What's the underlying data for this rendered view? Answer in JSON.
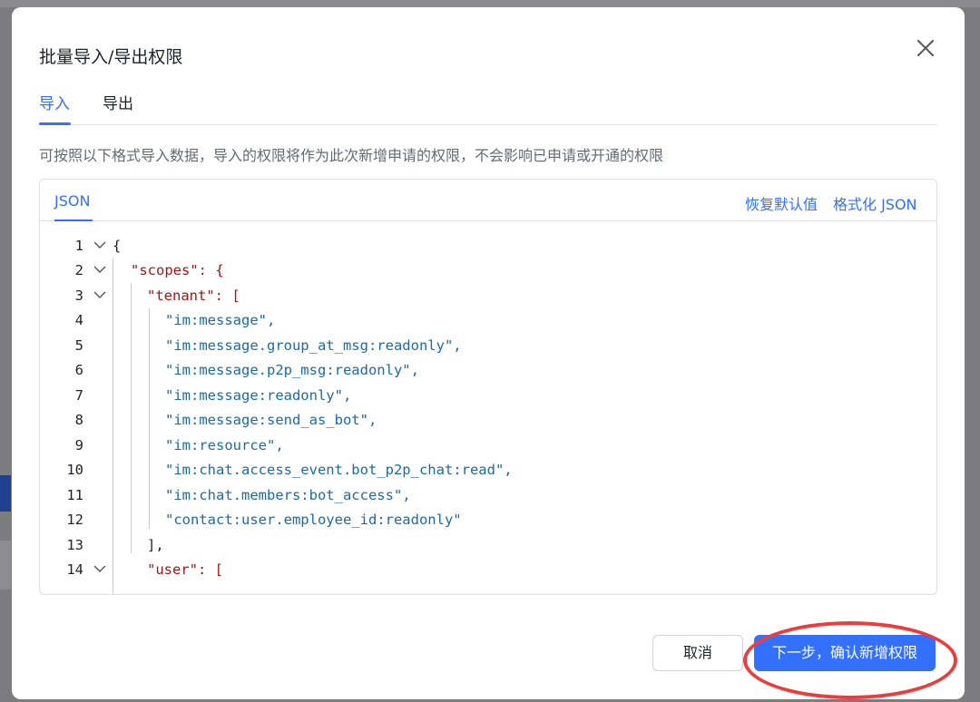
{
  "modal": {
    "title": "批量导入/导出权限"
  },
  "tabs": [
    {
      "label": "导入",
      "active": true
    },
    {
      "label": "导出",
      "active": false
    }
  ],
  "description": "可按照以下格式导入数据，导入的权限将作为此次新增申请的权限，不会影响已申请或开通的权限",
  "editor": {
    "tab_label": "JSON",
    "actions": [
      "恢复默认值",
      "格式化 JSON"
    ],
    "lines": [
      {
        "n": "1",
        "text": "{"
      },
      {
        "n": "2",
        "text": "\"scopes\": {"
      },
      {
        "n": "3",
        "text": "\"tenant\": ["
      },
      {
        "n": "4",
        "text": "\"im:message\","
      },
      {
        "n": "5",
        "text": "\"im:message.group_at_msg:readonly\","
      },
      {
        "n": "6",
        "text": "\"im:message.p2p_msg:readonly\","
      },
      {
        "n": "7",
        "text": "\"im:message:readonly\","
      },
      {
        "n": "8",
        "text": "\"im:message:send_as_bot\","
      },
      {
        "n": "9",
        "text": "\"im:resource\","
      },
      {
        "n": "10",
        "text": "\"im:chat.access_event.bot_p2p_chat:read\","
      },
      {
        "n": "11",
        "text": "\"im:chat.members:bot_access\","
      },
      {
        "n": "12",
        "text": "\"contact:user.employee_id:readonly\""
      },
      {
        "n": "13",
        "text": "],"
      },
      {
        "n": "14",
        "text": "\"user\": ["
      }
    ]
  },
  "footer": {
    "cancel_label": "取消",
    "confirm_label": "下一步，确认新增权限"
  },
  "colors": {
    "accent": "#3370ff",
    "annotation": "#ee3b3b",
    "json_key": "#a31515",
    "json_string": "#1c6aa8"
  },
  "icons": [
    "close-icon",
    "fold-chevron-icon"
  ]
}
